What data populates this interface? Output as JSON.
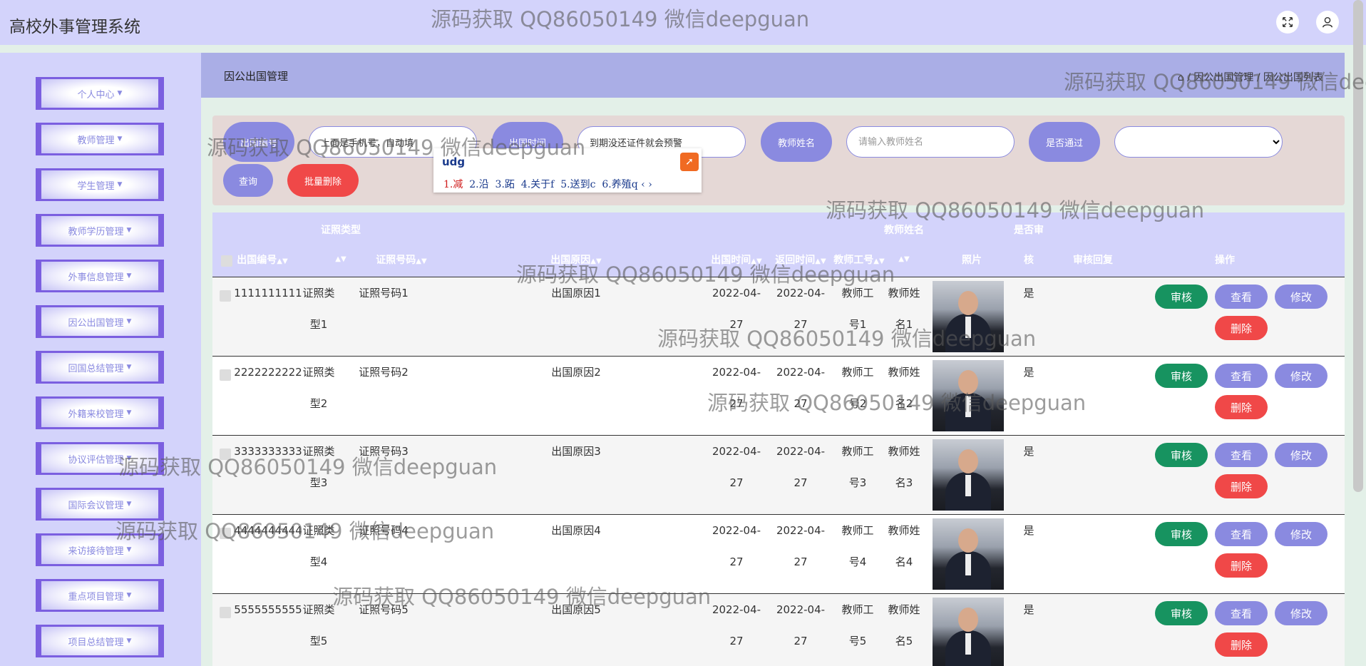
{
  "app_title": "高校外事管理系统",
  "header": {
    "fullscreen_icon": "expand-icon",
    "user_icon": "user-icon"
  },
  "sidebar": {
    "items": [
      {
        "label": "个人中心"
      },
      {
        "label": "教师管理"
      },
      {
        "label": "学生管理"
      },
      {
        "label": "教师学历管理"
      },
      {
        "label": "外事信息管理"
      },
      {
        "label": "因公出国管理"
      },
      {
        "label": "回国总结管理"
      },
      {
        "label": "外籍来校管理"
      },
      {
        "label": "协议评估管理"
      },
      {
        "label": "国际会议管理"
      },
      {
        "label": "来访接待管理"
      },
      {
        "label": "重点项目管理"
      },
      {
        "label": "项目总结管理"
      }
    ]
  },
  "breadcrumb": {
    "title": "因公出国管理",
    "path": "⌂ / 因公出国管理 / 因公出国列表"
  },
  "search": {
    "label1": "出国编号",
    "value1": "上面是手机号，自动填",
    "label2": "出国时间",
    "value2": "到期没还证件就会预警",
    "label3": "教师姓名",
    "placeholder3": "请输入教师姓名",
    "label4": "是否通过",
    "query": "查询",
    "batch_delete": "批量删除"
  },
  "ime": {
    "code": "udg",
    "candidates": [
      {
        "text": "1.减"
      },
      {
        "text": "2.沿"
      },
      {
        "text": "3.跖"
      },
      {
        "text": "4.关于f"
      },
      {
        "text": "5.送到c"
      },
      {
        "text": "6.养殖q"
      }
    ]
  },
  "table": {
    "headers": {
      "no": "出国编号",
      "type_top": "证照类型",
      "cert_no": "证照号码",
      "reason": "出国原因",
      "go_time": "出国时间",
      "return_time": "返回时间",
      "teacher_id": "教师工号",
      "name_top": "教师姓名",
      "photo": "照片",
      "audit_top": "是否审",
      "audit_bottom": "核",
      "reply": "审核回复",
      "ops": "操作"
    },
    "rows": [
      {
        "no": "1111111111",
        "type1": "证照类",
        "type2": "型1",
        "cert": "证照号码1",
        "reason": "出国原因1",
        "go1": "2022-04-",
        "go2": "27",
        "ret1": "2022-04-",
        "ret2": "27",
        "tid1": "教师工",
        "tid2": "号1",
        "name1": "教师姓",
        "name2": "名1",
        "audit": "是"
      },
      {
        "no": "2222222222",
        "type1": "证照类",
        "type2": "型2",
        "cert": "证照号码2",
        "reason": "出国原因2",
        "go1": "2022-04-",
        "go2": "27",
        "ret1": "2022-04-",
        "ret2": "27",
        "tid1": "教师工",
        "tid2": "号2",
        "name1": "教师姓",
        "name2": "名2",
        "audit": "是"
      },
      {
        "no": "3333333333",
        "type1": "证照类",
        "type2": "型3",
        "cert": "证照号码3",
        "reason": "出国原因3",
        "go1": "2022-04-",
        "go2": "27",
        "ret1": "2022-04-",
        "ret2": "27",
        "tid1": "教师工",
        "tid2": "号3",
        "name1": "教师姓",
        "name2": "名3",
        "audit": "是"
      },
      {
        "no": "4444444444",
        "type1": "证照类",
        "type2": "型4",
        "cert": "证照号码4",
        "reason": "出国原因4",
        "go1": "2022-04-",
        "go2": "27",
        "ret1": "2022-04-",
        "ret2": "27",
        "tid1": "教师工",
        "tid2": "号4",
        "name1": "教师姓",
        "name2": "名4",
        "audit": "是"
      },
      {
        "no": "5555555555",
        "type1": "证照类",
        "type2": "型5",
        "cert": "证照号码5",
        "reason": "出国原因5",
        "go1": "2022-04-",
        "go2": "27",
        "ret1": "2022-04-",
        "ret2": "27",
        "tid1": "教师工",
        "tid2": "号5",
        "name1": "教师姓",
        "name2": "名5",
        "audit": "是"
      }
    ],
    "actions": {
      "review": "审核",
      "view": "查看",
      "edit": "修改",
      "delete": "删除"
    }
  },
  "watermark": "源码获取 QQ86050149 微信deepguan",
  "colors": {
    "header_bg": "#d3d3fb",
    "accent": "#8a8ae0",
    "danger": "#f04848",
    "success": "#179360",
    "sidebar_border": "#7b5fe0"
  }
}
